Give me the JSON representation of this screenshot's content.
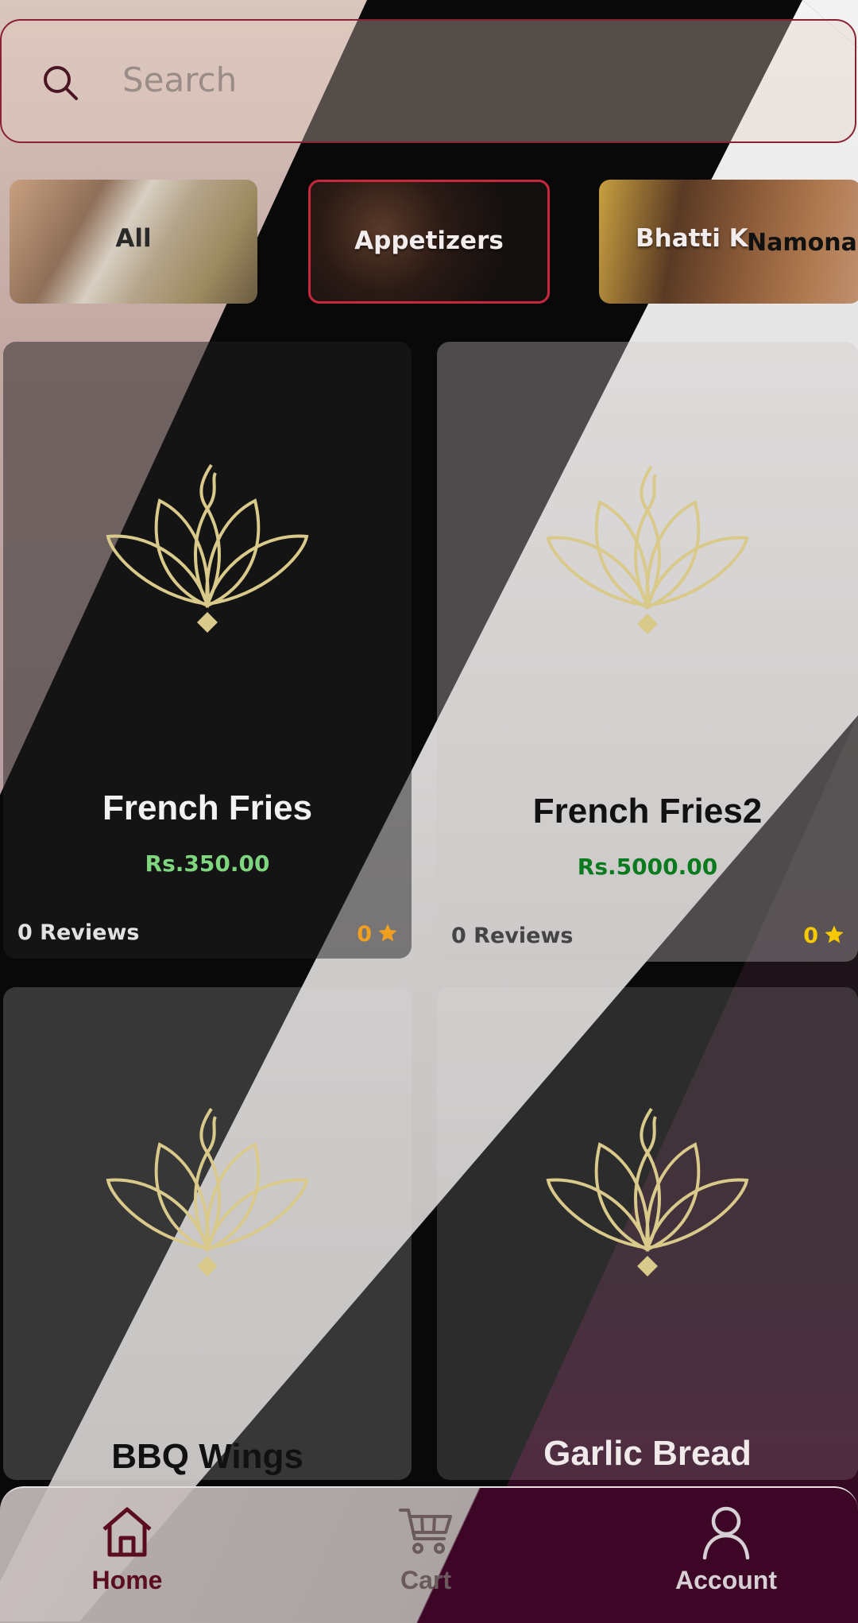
{
  "search": {
    "placeholder": "Search"
  },
  "categories": [
    {
      "label": "All",
      "selected": false
    },
    {
      "label": "Appetizers",
      "selected": true
    },
    {
      "label": "Bhatti K",
      "overlap_label": "Namona",
      "selected": false
    }
  ],
  "products": [
    {
      "name": "French Fries",
      "price": "Rs.350.00",
      "reviews": "0 Reviews",
      "rating": "0"
    },
    {
      "name": "French Fries2",
      "price": "Rs.5000.00",
      "reviews": "0 Reviews",
      "rating": "0"
    },
    {
      "name": "BBQ Wings"
    },
    {
      "name": "Garlic Bread"
    }
  ],
  "nav": {
    "home": "Home",
    "cart": "Cart",
    "account": "Account",
    "active": "Home"
  },
  "colors": {
    "accent": "#c8283c",
    "nav_active": "#5a0d1e",
    "price_green_dark": "#0a7a1e",
    "price_green_light": "#7fd67f",
    "star": "#f5b800",
    "logo_gold": "#d9c98a"
  },
  "icons": [
    "search-icon",
    "star-icon",
    "lotus-logo-icon",
    "home-icon",
    "cart-icon",
    "account-icon"
  ]
}
